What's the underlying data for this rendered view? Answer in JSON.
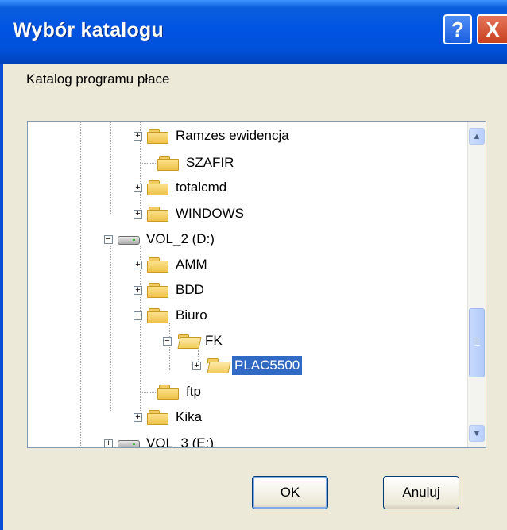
{
  "window": {
    "title": "Wybór katalogu",
    "help_label": "?",
    "close_label": "X"
  },
  "prompt": "Katalog programu płace",
  "tree": {
    "items": [
      {
        "label": "Ramzes ewidencja",
        "icon": "folder-icon",
        "expander": "+"
      },
      {
        "label": "SZAFIR",
        "icon": "folder-icon",
        "expander": ""
      },
      {
        "label": "totalcmd",
        "icon": "folder-icon",
        "expander": "+"
      },
      {
        "label": "WINDOWS",
        "icon": "folder-icon",
        "expander": "+"
      },
      {
        "label": "VOL_2 (D:)",
        "icon": "drive-icon",
        "expander": "−"
      },
      {
        "label": "AMM",
        "icon": "folder-icon",
        "expander": "+"
      },
      {
        "label": "BDD",
        "icon": "folder-icon",
        "expander": "+"
      },
      {
        "label": "Biuro",
        "icon": "folder-icon",
        "expander": "−"
      },
      {
        "label": "FK",
        "icon": "open-folder-icon",
        "expander": "−"
      },
      {
        "label": "PLAC5500",
        "icon": "open-folder-icon",
        "expander": "+",
        "selected": true
      },
      {
        "label": "ftp",
        "icon": "folder-icon",
        "expander": ""
      },
      {
        "label": "Kika",
        "icon": "folder-icon",
        "expander": "+"
      },
      {
        "label": "VOL_3 (E:)",
        "icon": "drive-icon",
        "expander": "+"
      }
    ]
  },
  "scrollbar": {
    "up_icon": "chevron-up-icon",
    "down_icon": "chevron-down-icon",
    "up_glyph": "▲",
    "down_glyph": "▼"
  },
  "buttons": {
    "ok": "OK",
    "cancel": "Anuluj"
  }
}
